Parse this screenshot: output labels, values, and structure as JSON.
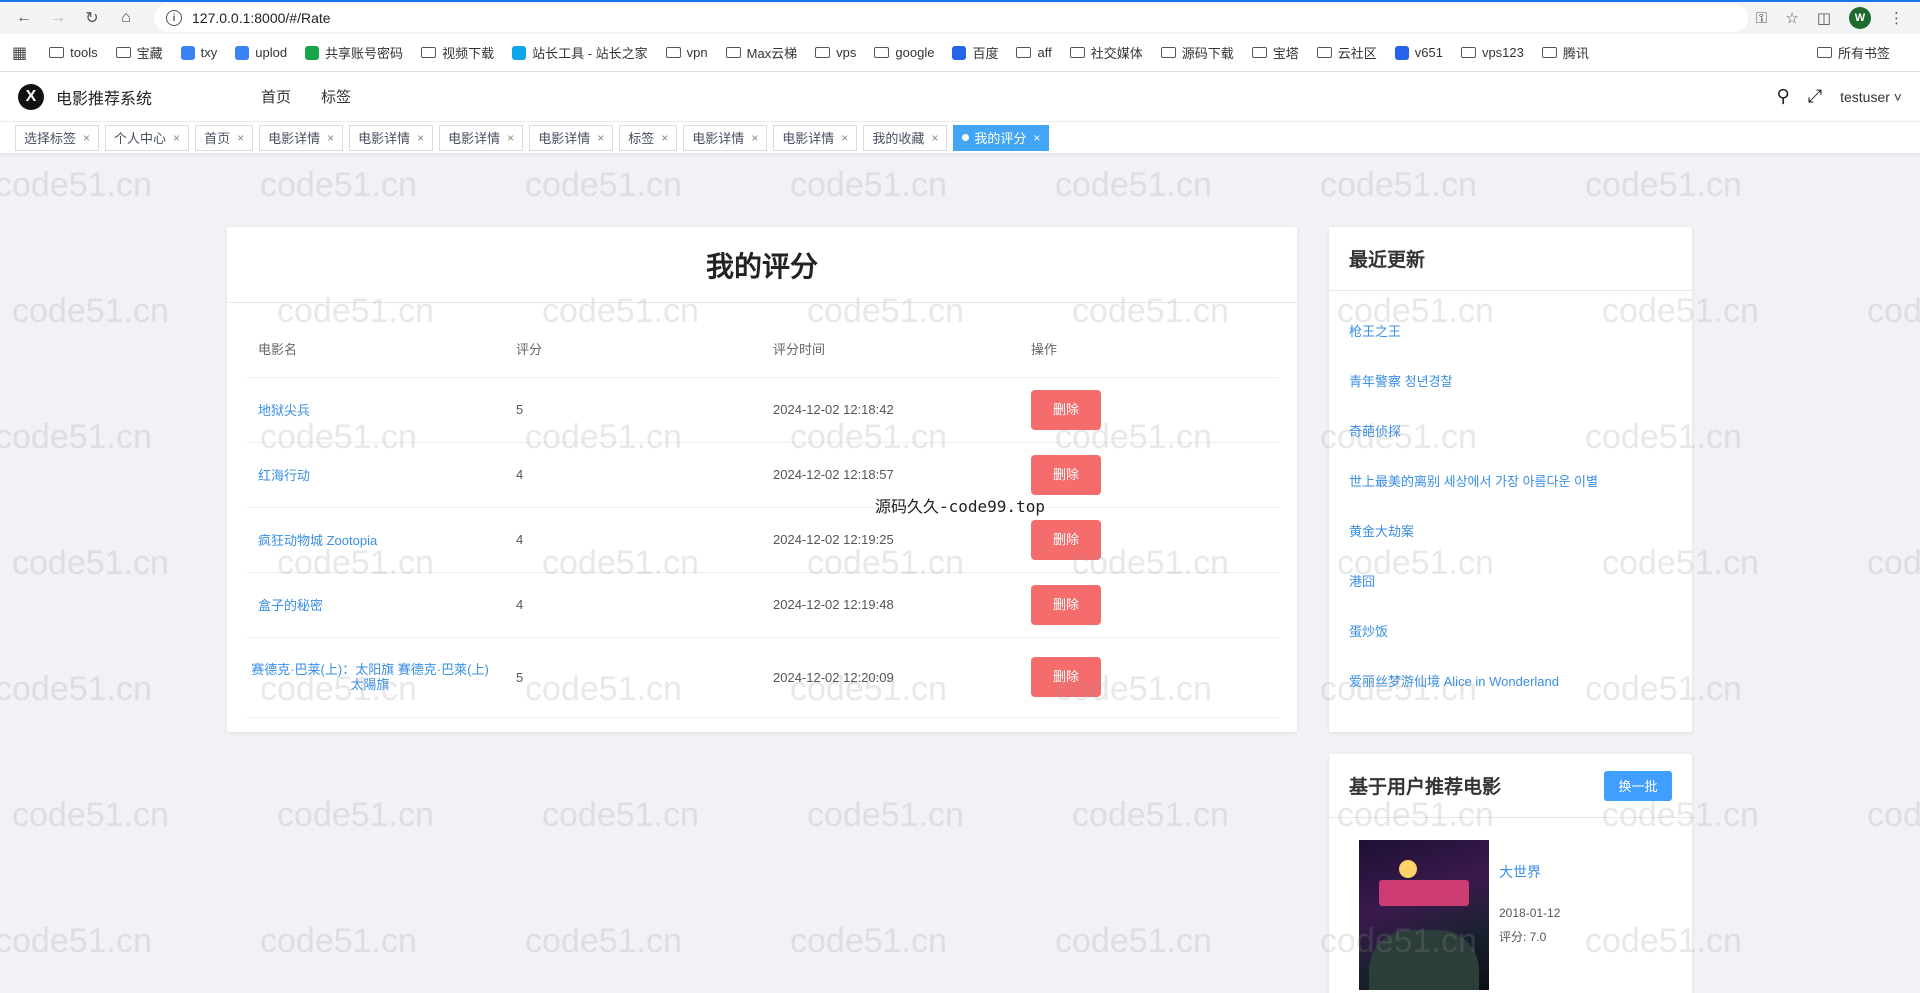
{
  "browser": {
    "url": "127.0.0.1:8000/#/Rate",
    "profile_initial": "W",
    "bookmarks": [
      "tools",
      "宝藏",
      "txy",
      "uplod",
      "共享账号密码",
      "视频下载",
      "站长工具 - 站长之家",
      "vpn",
      "Max云梯",
      "vps",
      "google",
      "百度",
      "aff",
      "社交媒体",
      "源码下载",
      "宝塔",
      "云社区",
      "v651",
      "vps123",
      "腾讯"
    ],
    "bookmarks_right": "所有书签"
  },
  "app": {
    "title": "电影推荐系统",
    "menu": [
      "首页",
      "标签"
    ],
    "user": "testuser"
  },
  "tabs": [
    {
      "label": "选择标签",
      "active": false
    },
    {
      "label": "个人中心",
      "active": false
    },
    {
      "label": "首页",
      "active": false
    },
    {
      "label": "电影详情",
      "active": false
    },
    {
      "label": "电影详情",
      "active": false
    },
    {
      "label": "电影详情",
      "active": false
    },
    {
      "label": "电影详情",
      "active": false
    },
    {
      "label": "标签",
      "active": false
    },
    {
      "label": "电影详情",
      "active": false
    },
    {
      "label": "电影详情",
      "active": false
    },
    {
      "label": "我的收藏",
      "active": false
    },
    {
      "label": "我的评分",
      "active": true
    }
  ],
  "rate": {
    "title": "我的评分",
    "headers": [
      "电影名",
      "评分",
      "评分时间",
      "操作"
    ],
    "delete_label": "删除",
    "rows": [
      {
        "movie": "地狱尖兵",
        "score": "5",
        "time": "2024-12-02 12:18:42"
      },
      {
        "movie": "红海行动",
        "score": "4",
        "time": "2024-12-02 12:18:57"
      },
      {
        "movie": "疯狂动物城 Zootopia",
        "score": "4",
        "time": "2024-12-02 12:19:25"
      },
      {
        "movie": "盒子的秘密",
        "score": "4",
        "time": "2024-12-02 12:19:48"
      },
      {
        "movie": "赛德克·巴莱(上)：太阳旗 賽德克·巴萊(上)太陽旗",
        "score": "5",
        "time": "2024-12-02 12:20:09"
      }
    ]
  },
  "latest": {
    "title": "最近更新",
    "items": [
      "枪王之王",
      "青年警察 청년경찰",
      "奇葩侦探",
      "世上最美的离别 세상에서 가장 아름다운 이별",
      "黄金大劫案",
      "港囧",
      "蛋炒饭",
      "爱丽丝梦游仙境 Alice in Wonderland"
    ]
  },
  "recommend": {
    "title": "基于用户推荐电影",
    "swap_label": "换一批",
    "movie": {
      "name": "大世界",
      "date": "2018-01-12",
      "score": "评分: 7.0"
    }
  },
  "overlay": "源码久久-code99.top",
  "watermark": "code51.cn"
}
